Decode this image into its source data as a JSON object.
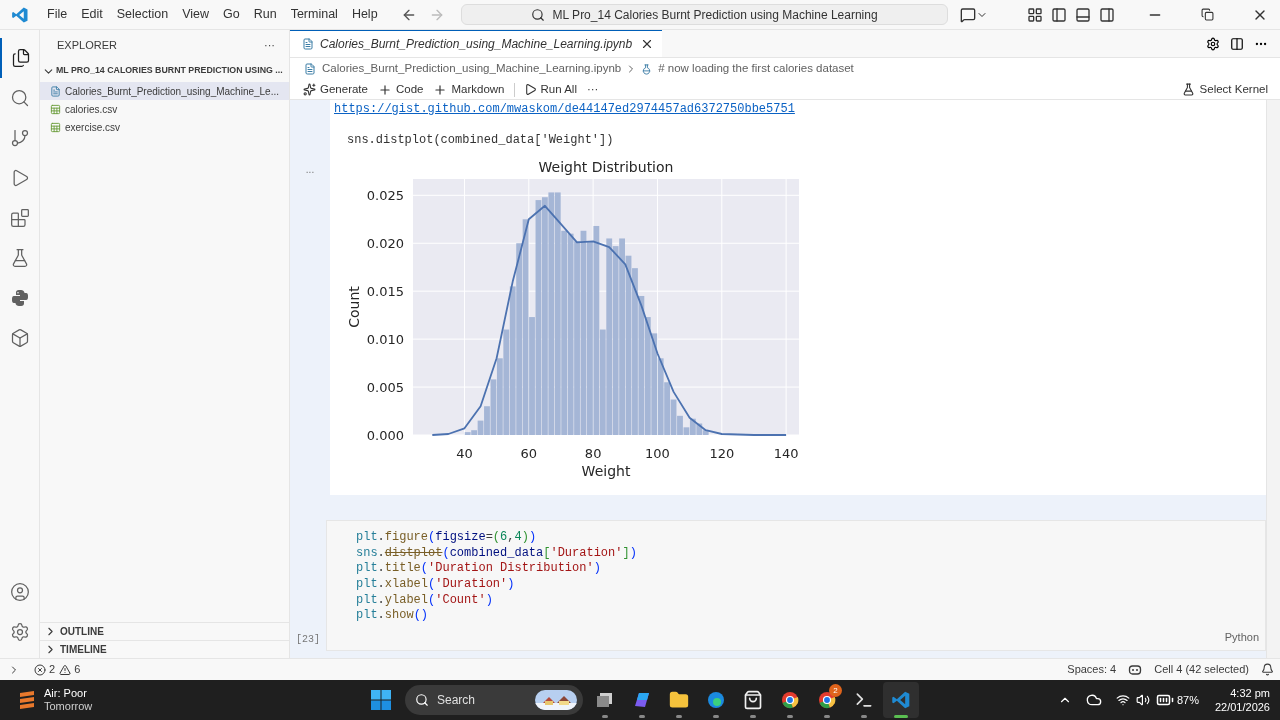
{
  "title_bar": {
    "menus": [
      "File",
      "Edit",
      "Selection",
      "View",
      "Go",
      "Run",
      "Terminal",
      "Help"
    ],
    "command_center": "ML Pro_14 Calories Burnt Prediction using Machine Learning"
  },
  "sidebar": {
    "title": "EXPLORER",
    "more": "···",
    "folder": {
      "label": "ML PRO_14 CALORIES BURNT PREDICTION USING ...",
      "expanded": true,
      "children": [
        {
          "label": "Calories_Burnt_Prediction_using_Machine_Le...",
          "kind": "notebook",
          "selected": true
        },
        {
          "label": "calories.csv",
          "kind": "csv",
          "selected": false
        },
        {
          "label": "exercise.csv",
          "kind": "csv",
          "selected": false
        }
      ]
    },
    "sections": [
      {
        "label": "OUTLINE",
        "expanded": false
      },
      {
        "label": "TIMELINE",
        "expanded": false
      }
    ]
  },
  "editor": {
    "tabs": [
      {
        "label": "Calories_Burnt_Prediction_using_Machine_Learning.ipynb",
        "selected": true
      }
    ],
    "breadcrumbs": [
      {
        "label": "Calories_Burnt_Prediction_using_Machine_Learning.ipynb",
        "kind": "notebook"
      },
      {
        "label": "# now loading the first calories dataset",
        "kind": "python"
      }
    ],
    "toolbar": [
      {
        "label": "Generate",
        "kind": "sparkle"
      },
      {
        "label": "Code",
        "kind": "plus"
      },
      {
        "label": "Markdown",
        "kind": "plus"
      },
      {
        "label": "Run All",
        "kind": "run"
      },
      {
        "label": "···",
        "kind": "more"
      }
    ],
    "kernel": "Select Kernel"
  },
  "cells": [
    {
      "kind": "output",
      "gutter": "...",
      "link": "https://gist.github.com/mwaskom/de44147ed2974457ad6372750bbe5751",
      "text": "sns.distplot(combined_data['Weight'])",
      "chart_data": {
        "type": "bar",
        "title": "Weight Distribution",
        "xlabel": "Weight",
        "ylabel": "Count",
        "xlim": [
          24,
          144
        ],
        "ylim": [
          0,
          0.0267
        ],
        "xticks": [
          40,
          60,
          80,
          100,
          120,
          140
        ],
        "yticks": [
          {
            "value": 0,
            "label": "0.000"
          },
          {
            "value": 0.005,
            "label": "0.005"
          },
          {
            "value": 0.01,
            "label": "0.010"
          },
          {
            "value": 0.015,
            "label": "0.015"
          },
          {
            "value": 0.02,
            "label": "0.020"
          },
          {
            "value": 0.025,
            "label": "0.025"
          }
        ],
        "grid": true,
        "x": [
          41,
          43,
          45,
          47,
          49,
          51,
          53,
          55,
          57,
          59,
          61,
          63,
          65,
          67,
          69,
          71,
          73,
          75,
          77,
          79,
          81,
          83,
          85,
          87,
          89,
          91,
          93,
          95,
          97,
          99,
          101,
          103,
          105,
          107,
          109,
          111,
          113,
          115
        ],
        "series": [
          {
            "type": "bar",
            "color": "#a5b6d6",
            "values": [
              0.0003,
              0.0005,
              0.0015,
              0.003,
              0.0058,
              0.008,
              0.011,
              0.0155,
              0.02,
              0.0225,
              0.0123,
              0.0245,
              0.0248,
              0.0253,
              0.0253,
              0.0213,
              0.021,
              0.0202,
              0.0213,
              0.0202,
              0.0218,
              0.011,
              0.0205,
              0.0197,
              0.0205,
              0.0187,
              0.0174,
              0.0145,
              0.0123,
              0.0106,
              0.008,
              0.0055,
              0.0037,
              0.002,
              0.0008,
              0.0017,
              0.0012,
              0.0005
            ]
          },
          {
            "type": "line",
            "color": "#4c72b0",
            "x": [
              30,
              35,
              40,
              45,
              50,
              55,
              60,
              65,
              70,
              75,
              80,
              85,
              90,
              95,
              100,
              105,
              110,
              115,
              120,
              130,
              140
            ],
            "values": [
              0,
              0.0001,
              0.0007,
              0.003,
              0.008,
              0.016,
              0.0225,
              0.0239,
              0.022,
              0.0201,
              0.0202,
              0.0196,
              0.0178,
              0.0135,
              0.0085,
              0.0045,
              0.0018,
              0.0005,
              0.0001,
              0,
              0
            ]
          }
        ]
      }
    },
    {
      "kind": "code",
      "count": "[23]",
      "language": "Python",
      "lines": [
        [
          {
            "text": "plt",
            "kind": "var"
          },
          {
            "text": ".",
            "kind": "plain"
          },
          {
            "text": "figure",
            "kind": "fn"
          },
          {
            "text": "(",
            "kind": "paren"
          },
          {
            "text": "figsize",
            "kind": "param"
          },
          {
            "text": "=",
            "kind": "plain"
          },
          {
            "text": "(",
            "kind": "paren2"
          },
          {
            "text": "6",
            "kind": "num"
          },
          {
            "text": ",",
            "kind": "plain"
          },
          {
            "text": "4",
            "kind": "num"
          },
          {
            "text": ")",
            "kind": "paren2"
          },
          {
            "text": ")",
            "kind": "paren"
          }
        ],
        [
          {
            "text": "sns",
            "kind": "var"
          },
          {
            "text": ".",
            "kind": "plain"
          },
          {
            "text": "distplot",
            "kind": "deprecated"
          },
          {
            "text": "(",
            "kind": "paren"
          },
          {
            "text": "combined_data",
            "kind": "param"
          },
          {
            "text": "[",
            "kind": "paren2"
          },
          {
            "text": "'Duration'",
            "kind": "str"
          },
          {
            "text": "]",
            "kind": "paren2"
          },
          {
            "text": ")",
            "kind": "paren"
          }
        ],
        [
          {
            "text": "plt",
            "kind": "var"
          },
          {
            "text": ".",
            "kind": "plain"
          },
          {
            "text": "title",
            "kind": "fn"
          },
          {
            "text": "(",
            "kind": "paren"
          },
          {
            "text": "'Duration Distribution'",
            "kind": "str"
          },
          {
            "text": ")",
            "kind": "paren"
          }
        ],
        [
          {
            "text": "plt",
            "kind": "var"
          },
          {
            "text": ".",
            "kind": "plain"
          },
          {
            "text": "xlabel",
            "kind": "fn"
          },
          {
            "text": "(",
            "kind": "paren"
          },
          {
            "text": "'Duration'",
            "kind": "str"
          },
          {
            "text": ")",
            "kind": "paren"
          }
        ],
        [
          {
            "text": "plt",
            "kind": "var"
          },
          {
            "text": ".",
            "kind": "plain"
          },
          {
            "text": "ylabel",
            "kind": "fn"
          },
          {
            "text": "(",
            "kind": "paren"
          },
          {
            "text": "'Count'",
            "kind": "str"
          },
          {
            "text": ")",
            "kind": "paren"
          }
        ],
        [
          {
            "text": "plt",
            "kind": "var"
          },
          {
            "text": ".",
            "kind": "plain"
          },
          {
            "text": "show",
            "kind": "fn"
          },
          {
            "text": "()",
            "kind": "paren"
          }
        ]
      ]
    }
  ],
  "status_bar": {
    "errors": "2",
    "warnings": "6",
    "spaces": "Spaces: 4",
    "cell": "Cell 4 (42 selected)"
  },
  "taskbar": {
    "weather": {
      "title": "Air: Poor",
      "subtitle": "Tomorrow"
    },
    "search": "Search",
    "apps": [
      {
        "kind": "files",
        "active": false
      },
      {
        "kind": "copilot",
        "active": false
      },
      {
        "kind": "folder",
        "active": false
      },
      {
        "kind": "edge",
        "active": false
      },
      {
        "kind": "store",
        "active": false
      },
      {
        "kind": "chrome",
        "active": false
      },
      {
        "kind": "chrome-badge",
        "active": false,
        "badge": "2"
      },
      {
        "kind": "terminal",
        "active": false
      },
      {
        "kind": "vscode",
        "active": true
      }
    ],
    "battery": "87%",
    "time": "4:32 pm",
    "date": "22/01/2026"
  }
}
